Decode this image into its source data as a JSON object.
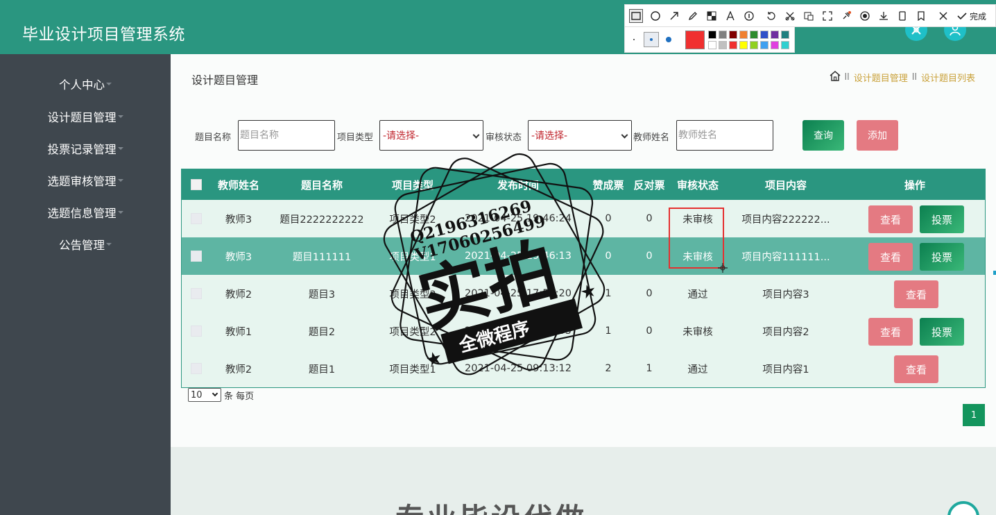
{
  "app": {
    "title": "毕业设计项目管理系统"
  },
  "header_icons": [
    "tools-icon",
    "user-icon"
  ],
  "sidebar": {
    "items": [
      {
        "label": "个人中心"
      },
      {
        "label": "设计题目管理"
      },
      {
        "label": "投票记录管理"
      },
      {
        "label": "选题审核管理"
      },
      {
        "label": "选题信息管理"
      },
      {
        "label": "公告管理"
      }
    ]
  },
  "page": {
    "title": "设计题目管理",
    "breadcrumb": [
      "设计题目管理",
      "设计题目列表"
    ]
  },
  "filters": {
    "title_label": "题目名称",
    "title_placeholder": "题目名称",
    "type_label": "项目类型",
    "type_value": "-请选择-",
    "status_label": "审核状态",
    "status_value": "-请选择-",
    "teacher_label": "教师姓名",
    "teacher_placeholder": "教师姓名",
    "query_button": "查询",
    "add_button": "添加"
  },
  "table": {
    "columns": [
      "教师姓名",
      "题目名称",
      "项目类型",
      "发布时间",
      "赞成票",
      "反对票",
      "审核状态",
      "项目内容",
      "操作"
    ],
    "rows": [
      {
        "teacher": "教师3",
        "title": "题目2222222222",
        "type": "项目类型2",
        "time": "2021-04-25 19:46:24",
        "for": "0",
        "against": "0",
        "status": "未审核",
        "content": "项目内容222222...",
        "actions": [
          "查看",
          "投票"
        ]
      },
      {
        "teacher": "教师3",
        "title": "题目111111",
        "type": "项目类型1",
        "time": "2021-04-25 19:46:13",
        "for": "0",
        "against": "0",
        "status": "未审核",
        "content": "项目内容111111...",
        "actions": [
          "查看",
          "投票"
        ]
      },
      {
        "teacher": "教师2",
        "title": "题目3",
        "type": "项目类型3",
        "time": "2021-04-25 17:59:20",
        "for": "1",
        "against": "0",
        "status": "通过",
        "content": "项目内容3",
        "actions": [
          "查看"
        ]
      },
      {
        "teacher": "教师1",
        "title": "题目2",
        "type": "项目类型2",
        "time": "2021-04-25 09:36:05",
        "for": "1",
        "against": "0",
        "status": "未审核",
        "content": "项目内容2",
        "actions": [
          "查看",
          "投票"
        ]
      },
      {
        "teacher": "教师2",
        "title": "题目1",
        "type": "项目类型1",
        "time": "2021-04-25 09:13:12",
        "for": "2",
        "against": "1",
        "status": "通过",
        "content": "项目内容1",
        "actions": [
          "查看"
        ]
      }
    ]
  },
  "pagination": {
    "page_size": "10",
    "page_size_suffix": "条 每页",
    "current_page": "1"
  },
  "footer": {
    "text": "专业毕设代做"
  },
  "watermark": {
    "line1": "Q2196316269",
    "line2": "V17060256499",
    "main": "实拍",
    "banner": "全微程序"
  },
  "screenshot_toolbar": {
    "done_label": "完成"
  },
  "colors": {
    "header": "#2a9680",
    "sidebar": "#3f474e",
    "accent_green": "#13955d",
    "accent_pink": "#e47a82",
    "breadcrumb": "#c9a13a",
    "select_text": "#c0262e"
  },
  "palette": [
    "#000000",
    "#808080",
    "#800000",
    "#f08030",
    "#2e8b2e",
    "#3050c8",
    "#7030a0",
    "#208080",
    "#ffffff",
    "#c0c0c0",
    "#f03030",
    "#ffff00",
    "#90d020",
    "#40a0f0",
    "#e040e0",
    "#30d0d0"
  ]
}
